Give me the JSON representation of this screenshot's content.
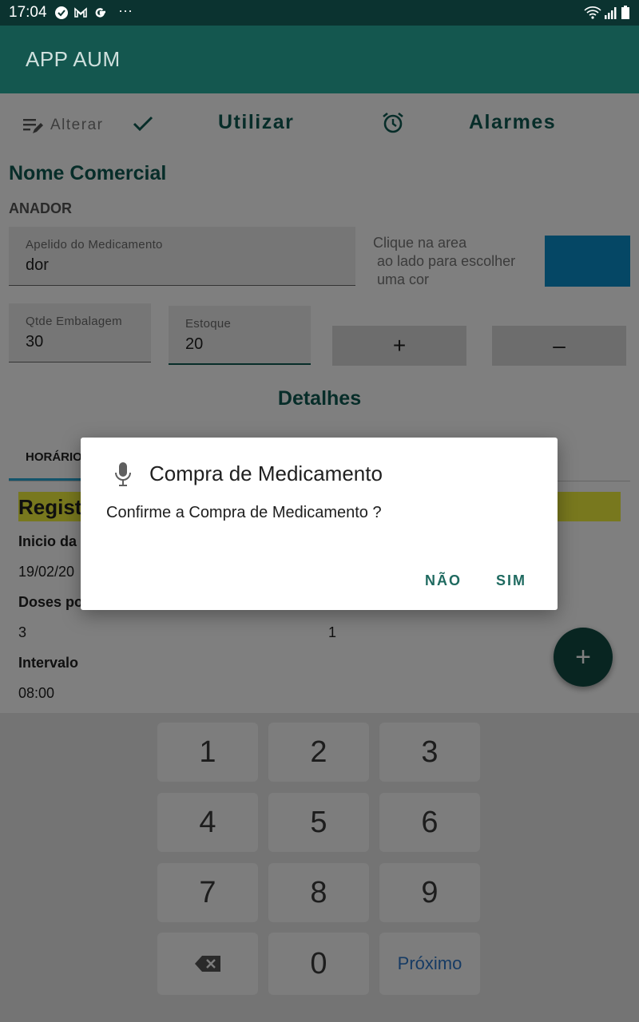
{
  "status_bar": {
    "time": "17:04",
    "more": "···"
  },
  "app_bar": {
    "title": "APP AUM"
  },
  "toolbar": {
    "edit_label": "Alterar",
    "use_label": "Utilizar",
    "alarms_label": "Alarmes"
  },
  "medicine": {
    "section_title": "Nome Comercial",
    "commercial_name": "ANADOR",
    "nickname_label": "Apelido do Medicamento",
    "nickname_value": "dor",
    "color_hint": "Clique na area\n ao lado para escolher\n uma cor",
    "color_value": "#0a8ecb",
    "package_qty_label": "Qtde Embalagem",
    "package_qty_value": "30",
    "stock_label": "Estoque",
    "stock_value": "20",
    "plus_label": "+",
    "minus_label": "–"
  },
  "details": {
    "title": "Detalhes",
    "tab_schedule": "HORÁRIOS",
    "register_partial": "Regist",
    "start_label_partial": "Inicio da",
    "start_value_partial": "19/02/20",
    "doses_label_partial": "Doses po",
    "doses_value": "3",
    "doses_second_value": "1",
    "interval_label": "Intervalo",
    "interval_value": "08:00"
  },
  "fab": {
    "label": "+"
  },
  "dialog": {
    "title": "Compra de Medicamento",
    "message": "Confirme a Compra de Medicamento ?",
    "no_label": "NÃO",
    "yes_label": "SIM"
  },
  "keypad": {
    "keys": [
      "1",
      "2",
      "3",
      "4",
      "5",
      "6",
      "7",
      "8",
      "9"
    ],
    "zero": "0",
    "next_label": "Próximo"
  },
  "colors": {
    "status_bar": "#0b3330",
    "app_bar": "#14574f",
    "accent": "#0f5a52",
    "tab_indicator": "#29a9d6",
    "highlight": "#f0f03c",
    "fab": "#104a43"
  }
}
